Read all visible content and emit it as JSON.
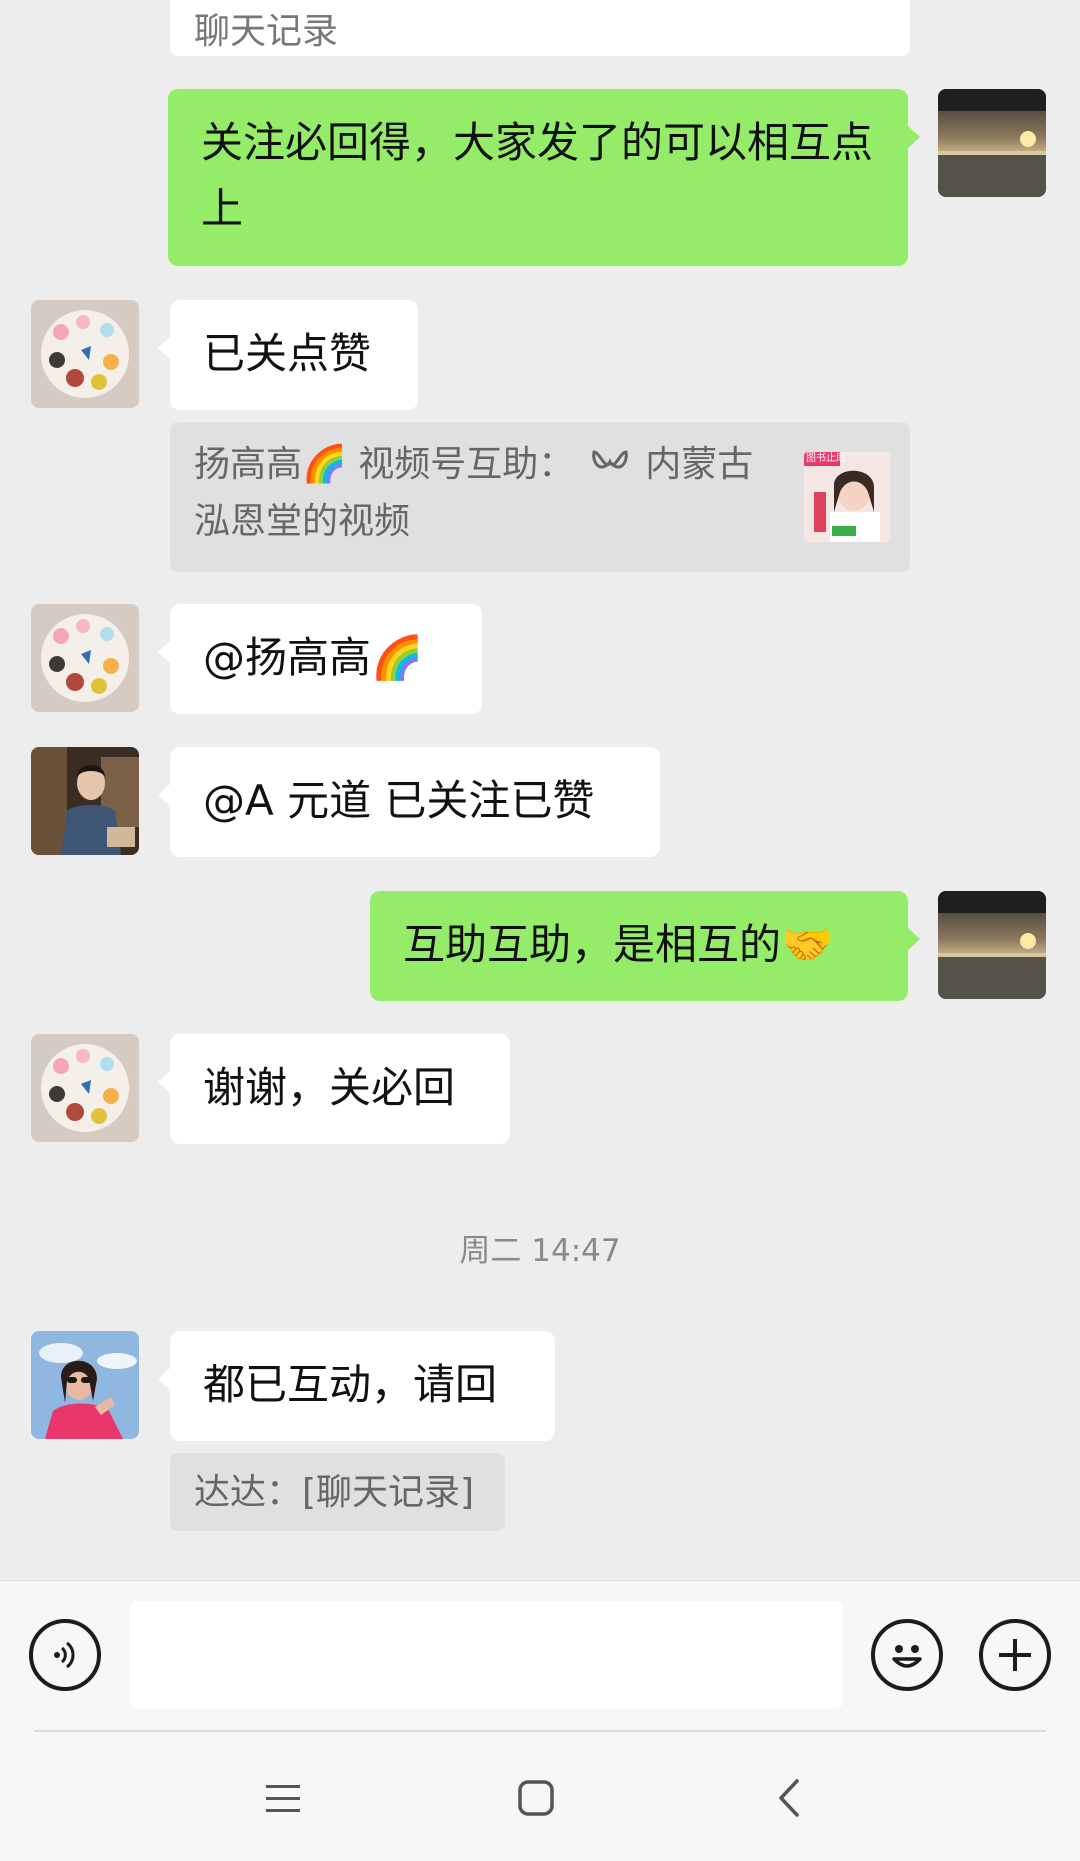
{
  "messages": {
    "top_quote": "聊天记录",
    "m1_text": "关注必回得，大家发了的可以相互点上",
    "m2_text": "已关点赞",
    "m2_quote": {
      "text": "扬高高🌈 视频号互助：",
      "channel_suffix": "内蒙古泓恩堂的视频",
      "thumb_text": "图书止库"
    },
    "m3_text": "@扬高高🌈",
    "m4_text": "@A 元道  已关注已赞",
    "m5_text": "互助互助，是相互的🤝",
    "m6_text": "谢谢，关必回",
    "timestamp": "周二 14:47",
    "m7_text": "都已互动，请回",
    "m7_quote": "达达：[聊天记录]"
  },
  "icons": {
    "voice": "voice-icon",
    "emoji": "emoji-icon",
    "plus": "plus-icon",
    "menu": "menu-icon",
    "home": "home-icon",
    "back": "back-icon",
    "channels": "channels-icon"
  },
  "colors": {
    "background": "#ededed",
    "bubble_green": "#95ec69",
    "bubble_white": "#ffffff",
    "quote_gray": "#e0e0e0"
  }
}
